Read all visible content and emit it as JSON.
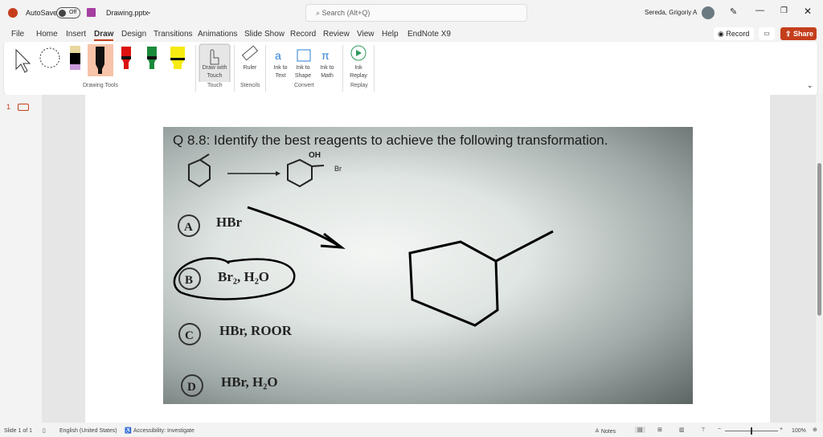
{
  "titlebar": {
    "autosave": "AutoSave",
    "toggle": "Off",
    "filename": "Drawing.pptx",
    "search_placeholder": "Search (Alt+Q)",
    "user": "Sereda, Grigoriy A"
  },
  "tabs": [
    "File",
    "Home",
    "Insert",
    "Draw",
    "Design",
    "Transitions",
    "Animations",
    "Slide Show",
    "Record",
    "Review",
    "View",
    "Help",
    "EndNote X9"
  ],
  "actions": {
    "record": "Record",
    "share": "Share"
  },
  "ribbon": {
    "draw_touch": "Draw with Touch",
    "ruler": "Ruler",
    "ink_text": "Ink to Text",
    "ink_shape": "Ink to Shape",
    "ink_math": "Ink to Math",
    "ink_replay": "Ink Replay",
    "groups": {
      "drawing_tools": "Drawing Tools",
      "touch": "Touch",
      "stencils": "Stencils",
      "convert": "Convert",
      "replay": "Replay"
    }
  },
  "thumb": {
    "number": "1"
  },
  "slide": {
    "question": "Q 8.8: Identify the best reagents to achieve the following transformation.",
    "oh": "OH",
    "br": "Br",
    "options": [
      {
        "letter": "A",
        "text": "HBr"
      },
      {
        "letter": "B",
        "text": "Br₂, H₂O"
      },
      {
        "letter": "C",
        "text": "HBr, ROOR"
      },
      {
        "letter": "D",
        "text": "HBr, H₂O"
      }
    ]
  },
  "status": {
    "slide": "Slide 1 of 1",
    "language": "English (United States)",
    "accessibility": "Accessibility: Investigate",
    "notes": "Notes",
    "zoom": "100%"
  }
}
